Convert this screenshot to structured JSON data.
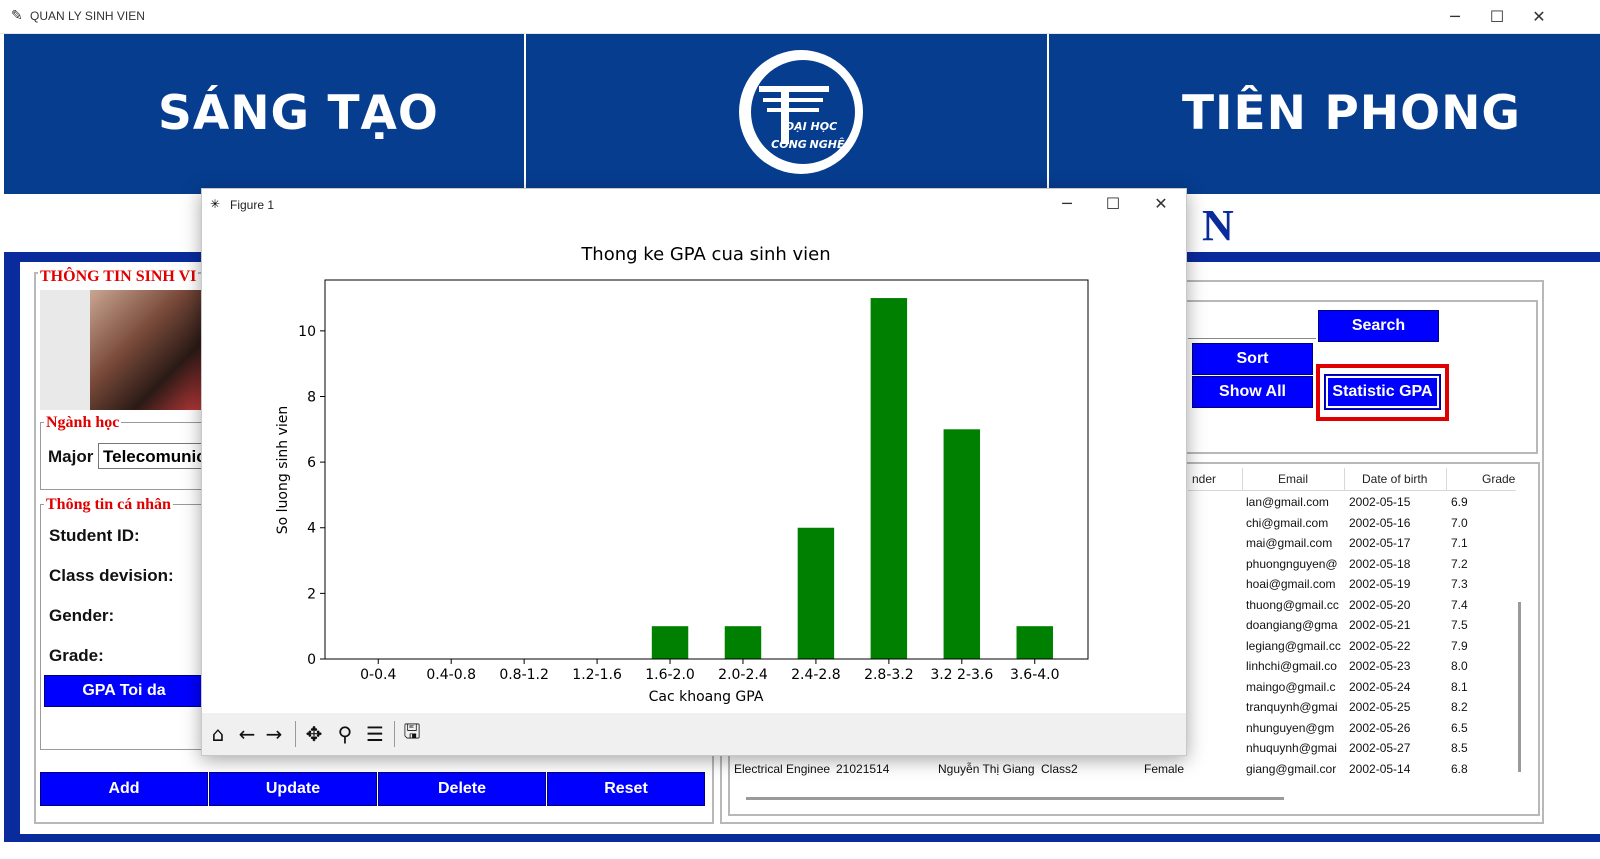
{
  "app": {
    "title": "QUAN LY SINH VIEN"
  },
  "banner": {
    "left_text": "SÁNG TẠO",
    "right_text": "TIÊN PHONG",
    "logo_line1": "ĐẠI HỌC",
    "logo_line2a": "CÔNG",
    "logo_line2b": "NGHỆ",
    "subtitle_tail": "N"
  },
  "left_panel": {
    "group_info": "THÔNG TIN SINH VI",
    "group_major": "Ngành học",
    "major_label": "Major",
    "major_value": "Telecomunic",
    "group_personal": "Thông tin cá nhân",
    "student_id_label": "Student ID:",
    "class_label": "Class devision:",
    "gender_label": "Gender:",
    "grade_label": "Grade:",
    "gpa_max_button": "GPA Toi da"
  },
  "actions": {
    "add": "Add",
    "update": "Update",
    "delete": "Delete",
    "reset": "Reset"
  },
  "search": {
    "search_button": "Search",
    "sort_button": "Sort",
    "show_all_button": "Show All",
    "statistic_button": "Statistic GPA"
  },
  "table": {
    "headers": {
      "gender": "nder",
      "email": "Email",
      "dob": "Date of birth",
      "grade": "Grade"
    },
    "rows": [
      {
        "email": "lan@gmail.com",
        "dob": "2002-05-15",
        "grade": "6.9"
      },
      {
        "email": "chi@gmail.com",
        "dob": "2002-05-16",
        "grade": "7.0"
      },
      {
        "email": "mai@gmail.com",
        "dob": "2002-05-17",
        "grade": "7.1"
      },
      {
        "email": "phuongnguyen@",
        "dob": "2002-05-18",
        "grade": "7.2"
      },
      {
        "email": "hoai@gmail.com",
        "dob": "2002-05-19",
        "grade": "7.3"
      },
      {
        "email": "thuong@gmail.cc",
        "dob": "2002-05-20",
        "grade": "7.4"
      },
      {
        "email": "doangiang@gma",
        "dob": "2002-05-21",
        "grade": "7.5"
      },
      {
        "email": "legiang@gmail.cc",
        "dob": "2002-05-22",
        "grade": "7.9"
      },
      {
        "email": "linhchi@gmail.co",
        "dob": "2002-05-23",
        "grade": "8.0"
      },
      {
        "email": "maingo@gmail.c",
        "dob": "2002-05-24",
        "grade": "8.1"
      },
      {
        "email": "tranquynh@gmai",
        "dob": "2002-05-25",
        "grade": "8.2"
      },
      {
        "email": "nhunguyen@gm",
        "dob": "2002-05-26",
        "grade": "6.5"
      },
      {
        "email": "nhuquynh@gmai",
        "dob": "2002-05-27",
        "grade": "8.5"
      }
    ],
    "last_row": {
      "major": "Electrical Enginee",
      "id": "21021514",
      "name": "Nguyễn Thị Giang",
      "class": "Class2",
      "gender": "Female",
      "email": "giang@gmail.cor",
      "dob": "2002-05-14",
      "grade": "6.8"
    }
  },
  "figure": {
    "title": "Figure 1"
  },
  "chart_data": {
    "type": "bar",
    "title": "Thong ke GPA cua sinh vien",
    "xlabel": "Cac khoang GPA",
    "ylabel": "So luong sinh vien",
    "categories": [
      "0-0.4",
      "0.4-0.8",
      "0.8-1.2",
      "1.2-1.6",
      "1.6-2.0",
      "2.0-2.4",
      "2.4-2.8",
      "2.8-3.2",
      "3.2 2-3.6",
      "3.6-4.0"
    ],
    "values": [
      0,
      0,
      0,
      0,
      1,
      1,
      4,
      11,
      7,
      1
    ],
    "ylim": [
      0,
      11.55
    ],
    "yticks": [
      0,
      2,
      4,
      6,
      8,
      10
    ],
    "bar_color": "#008000",
    "grid": false
  },
  "colors": {
    "banner_blue": "#063d8f",
    "frame_blue": "#0a2b9c",
    "button_blue": "#0000ff",
    "highlight_red": "#e00000"
  }
}
